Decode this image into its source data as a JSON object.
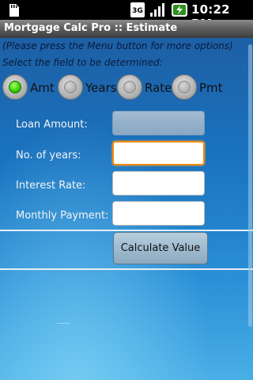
{
  "status_bar": {
    "time": "10:22 PM",
    "network": "3G",
    "icons": [
      "sd-card-icon",
      "3g-icon",
      "signal-icon",
      "battery-charging-icon"
    ]
  },
  "app": {
    "title": "Mortgage Calc Pro :: Estimate"
  },
  "hints": {
    "menu_hint": "(Please press the Menu button for more options)",
    "select_hint": "Select the field to be determined:"
  },
  "radio_options": [
    {
      "label": "Amt",
      "selected": true
    },
    {
      "label": "Years",
      "selected": false
    },
    {
      "label": "Rate",
      "selected": false
    },
    {
      "label": "Pmt",
      "selected": false
    }
  ],
  "fields": [
    {
      "label": "Loan Amount:",
      "value": "",
      "state": "disabled"
    },
    {
      "label": "No. of years:",
      "value": "",
      "state": "focused"
    },
    {
      "label": "Interest Rate:",
      "value": "",
      "state": "normal"
    },
    {
      "label": "Monthly Payment:",
      "value": "",
      "state": "normal"
    }
  ],
  "calculate_button": {
    "label": "Calculate Value"
  },
  "colors": {
    "title_bar": "#5c5c5c",
    "background_top": "#1d5fa5",
    "background_bottom": "#4aaee6",
    "radio_selected": "#33cc00",
    "focus_border": "#f08a00"
  }
}
